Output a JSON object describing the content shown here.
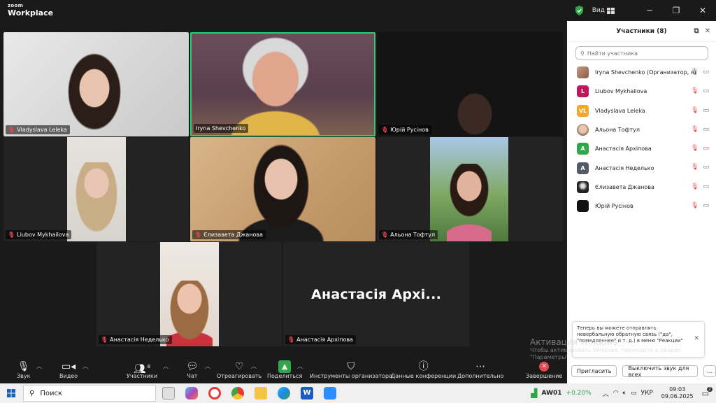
{
  "app": {
    "logo_line1": "zoom",
    "logo_line2": "Workplace",
    "view_label": "Вид",
    "accent": "#2d8cff"
  },
  "tiles": [
    {
      "name": "Vladyslava Leleka",
      "muted": true
    },
    {
      "name": "Iryna Shevchenko",
      "muted": false,
      "active_speaker": true
    },
    {
      "name": "Юрій Русінов",
      "muted": true
    },
    {
      "name": "Liubov Mykhailova",
      "muted": true
    },
    {
      "name": "Єлизавета Джанова",
      "muted": true
    },
    {
      "name": "Альона Тофтул",
      "muted": true
    },
    {
      "name": "Анастасія Неделько",
      "muted": true
    },
    {
      "name": "Анастасія Архіпова",
      "muted": true,
      "big_label": "Анастасія Архі..."
    }
  ],
  "panel": {
    "title": "Участники (8)",
    "search_placeholder": "Найти участника",
    "participants": [
      {
        "name": "Iryna Shevchenko (Организатор, я)",
        "initials": "",
        "color": "#b0856a",
        "mic": "on"
      },
      {
        "name": "Liubov Mykhailova",
        "initials": "L",
        "color": "#c2185b",
        "mic": "off"
      },
      {
        "name": "Vladyslava Leleka",
        "initials": "VL",
        "color": "#f5a623",
        "mic": "off"
      },
      {
        "name": "Альона Тофтул",
        "initials": "",
        "color": "#d8b9a0",
        "mic": "off"
      },
      {
        "name": "Анастасія Архіпова",
        "initials": "A",
        "color": "#2ea84a",
        "mic": "off",
        "cam": "off"
      },
      {
        "name": "Анастасія Неделько",
        "initials": "A",
        "color": "#555a66",
        "mic": "off"
      },
      {
        "name": "Єлизавета Джанова",
        "initials": "",
        "color": "#222222",
        "mic": "off"
      },
      {
        "name": "Юрій Русінов",
        "initials": "",
        "color": "#111111",
        "mic": "off"
      }
    ],
    "toast": "Теперь вы можете отправлять невербальную обратную связь (\"да\", \"помедленнее\" и т. д.) в меню \"Реакции\"",
    "invite_label": "Пригласить",
    "mute_all_label": "Выключить звук для всех",
    "more_label": "..."
  },
  "watermark": {
    "line1": "Активация Windows",
    "line2": "Чтобы активировать Windows, перейдите в раздел",
    "line3": "\"Параметры\"."
  },
  "toolbar": {
    "audio": "Звук",
    "video": "Видео",
    "participants": "Участники",
    "participants_count": "8",
    "chat": "Чат",
    "react": "Отреагировать",
    "share": "Поделиться",
    "host_tools": "Инструменты организатора",
    "meeting_info": "Данные конференции",
    "more": "Дополнительно",
    "end": "Завершение"
  },
  "taskbar": {
    "search": "Поиск",
    "stock_ticker": "AW01",
    "stock_change": "+0.20%",
    "language": "УКР",
    "time": "09:03",
    "date": "09.06.2025",
    "notif_count": "2"
  }
}
